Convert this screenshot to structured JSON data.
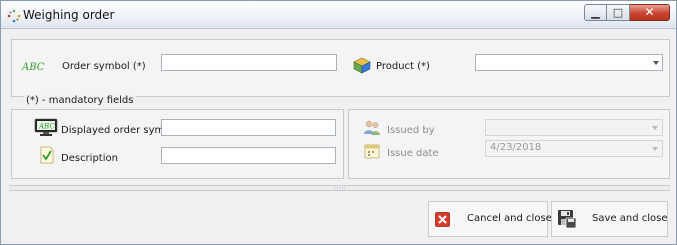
{
  "window": {
    "title": "Weighing order"
  },
  "colors": {
    "close_button": "#c9442e",
    "accent_green": "#2e9c2e"
  },
  "order_symbol": {
    "prefix": "ABC",
    "label": "Order symbol (*)",
    "value": ""
  },
  "product": {
    "label": "Product (*)",
    "value": ""
  },
  "mandatory_note": "(*) - mandatory fields",
  "displayed_order_symbol": {
    "label": "Displayed order symbol",
    "value": ""
  },
  "description": {
    "label": "Description",
    "value": ""
  },
  "issued_by": {
    "label": "Issued by",
    "value": ""
  },
  "issue_date": {
    "label": "Issue date",
    "value": "4/23/2018"
  },
  "buttons": {
    "cancel_close": "Cancel and close",
    "save_close": "Save and close"
  },
  "icons": [
    "app-icon",
    "minimize-icon",
    "maximize-icon",
    "close-icon",
    "abc-icon",
    "product-box-icon",
    "monitor-abc-icon",
    "document-check-icon",
    "users-icon",
    "calendar-icon",
    "cancel-x-icon",
    "save-disk-icon"
  ]
}
